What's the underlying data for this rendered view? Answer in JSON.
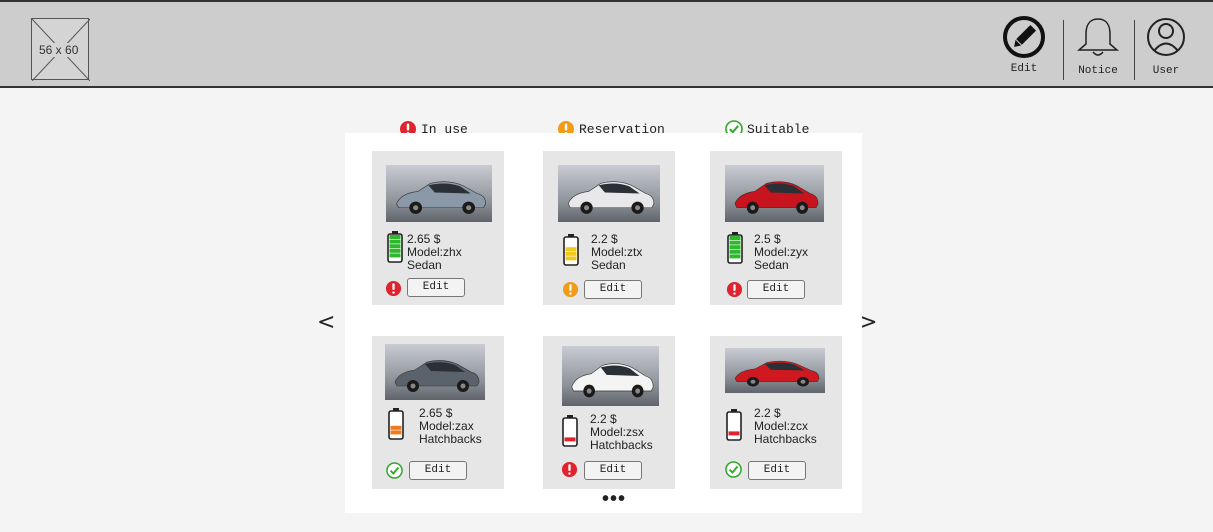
{
  "header": {
    "logo_placeholder": "56 x 60",
    "actions": [
      {
        "label": "Edit",
        "icon": "pencil-circle-icon"
      },
      {
        "label": "Notice",
        "icon": "bell-icon"
      },
      {
        "label": "User",
        "icon": "user-icon"
      }
    ]
  },
  "legend": [
    {
      "label": "In use",
      "icon": "red-exclamation-icon",
      "color": "#e0242f"
    },
    {
      "label": "Reservation",
      "icon": "orange-exclamation-icon",
      "color": "#f39a17"
    },
    {
      "label": "Suitable",
      "icon": "green-check-icon",
      "color": "#2fa829"
    }
  ],
  "nav": {
    "prev": "<",
    "next": ">",
    "more": "•••"
  },
  "cars": [
    {
      "price": "2.65 $",
      "model": "Model:zhx",
      "type": "Sedan",
      "battery": 1.0,
      "battery_color": "#2db82d",
      "status": "in-use",
      "car_color": "#8a98a8",
      "edit": "Edit"
    },
    {
      "price": "2.2 $",
      "model": "Model:ztx",
      "type": "Sedan",
      "battery": 0.6,
      "battery_color": "#f2c81a",
      "status": "reservation",
      "car_color": "#e8e8ea",
      "edit": "Edit"
    },
    {
      "price": "2.5 $",
      "model": "Model:zyx",
      "type": "Sedan",
      "battery": 1.0,
      "battery_color": "#2db82d",
      "status": "in-use",
      "car_color": "#c8141e",
      "edit": "Edit"
    },
    {
      "price": "2.65 $",
      "model": "Model:zax",
      "type": "Hatchbacks",
      "battery": 0.4,
      "battery_color": "#f07b1a",
      "status": "suitable",
      "car_color": "#5a626c",
      "edit": "Edit"
    },
    {
      "price": "2.2 $",
      "model": "Model:zsx",
      "type": "Hatchbacks",
      "battery": 0.2,
      "battery_color": "#e0242f",
      "status": "in-use",
      "car_color": "#f4f4f4",
      "edit": "Edit"
    },
    {
      "price": "2.2 $",
      "model": "Model:zcx",
      "type": "Hatchbacks",
      "battery": 0.2,
      "battery_color": "#e0242f",
      "status": "suitable",
      "car_color": "#d01820",
      "edit": "Edit"
    }
  ]
}
